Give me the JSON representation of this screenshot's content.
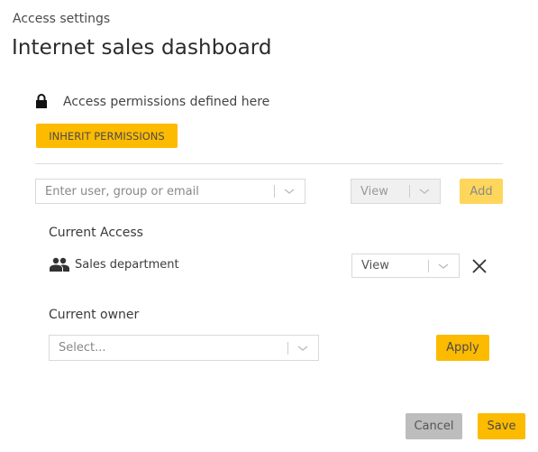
{
  "header": {
    "subtitle": "Access settings",
    "title": "Internet sales dashboard"
  },
  "permissions": {
    "icon": "lock-icon",
    "status_text": "Access permissions defined here",
    "inherit_button": "INHERIT PERMISSIONS"
  },
  "add_access": {
    "user_input_placeholder": "Enter user, group or email",
    "permission_select_value": "View",
    "add_button": "Add"
  },
  "current_access": {
    "label": "Current Access",
    "entries": [
      {
        "icon": "group-icon",
        "name": "Sales department",
        "permission": "View"
      }
    ]
  },
  "current_owner": {
    "label": "Current owner",
    "select_placeholder": "Select...",
    "apply_button": "Apply"
  },
  "footer": {
    "cancel_button": "Cancel",
    "save_button": "Save"
  },
  "colors": {
    "accent": "#fdbb00",
    "accent_disabled": "#fed65b",
    "cancel_bg": "#bdbdbd"
  }
}
